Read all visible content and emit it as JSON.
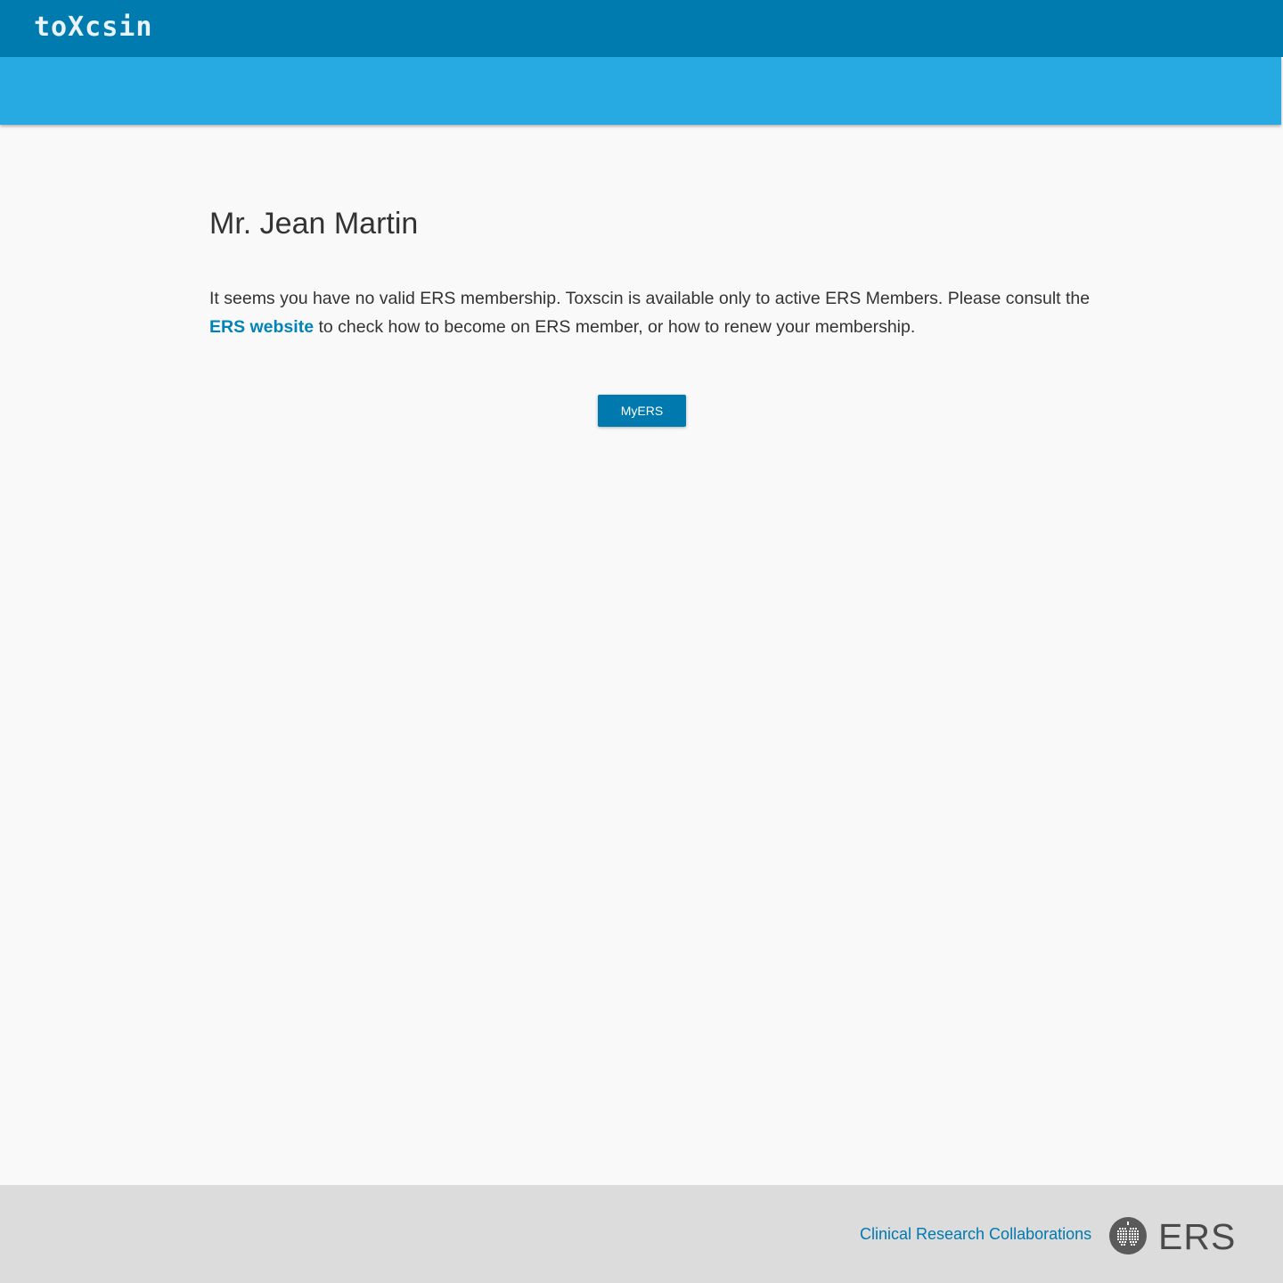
{
  "header": {
    "brand": "toXcsin"
  },
  "main": {
    "user_name": "Mr. Jean Martin",
    "message_part1": "It seems you have no valid ERS membership. Toxscin is available only to active ERS Members. Please consult the ",
    "message_link": "ERS website",
    "message_part2": " to check how to become on ERS member, or how to renew your membership.",
    "button_label": "MyERS"
  },
  "footer": {
    "link_label": "Clinical Research Collaborations",
    "logo_text": "ERS"
  },
  "colors": {
    "header_dark": "#007bb0",
    "header_light": "#27aae1",
    "accent": "#0079ae",
    "footer_bg": "#dcdcdc"
  }
}
